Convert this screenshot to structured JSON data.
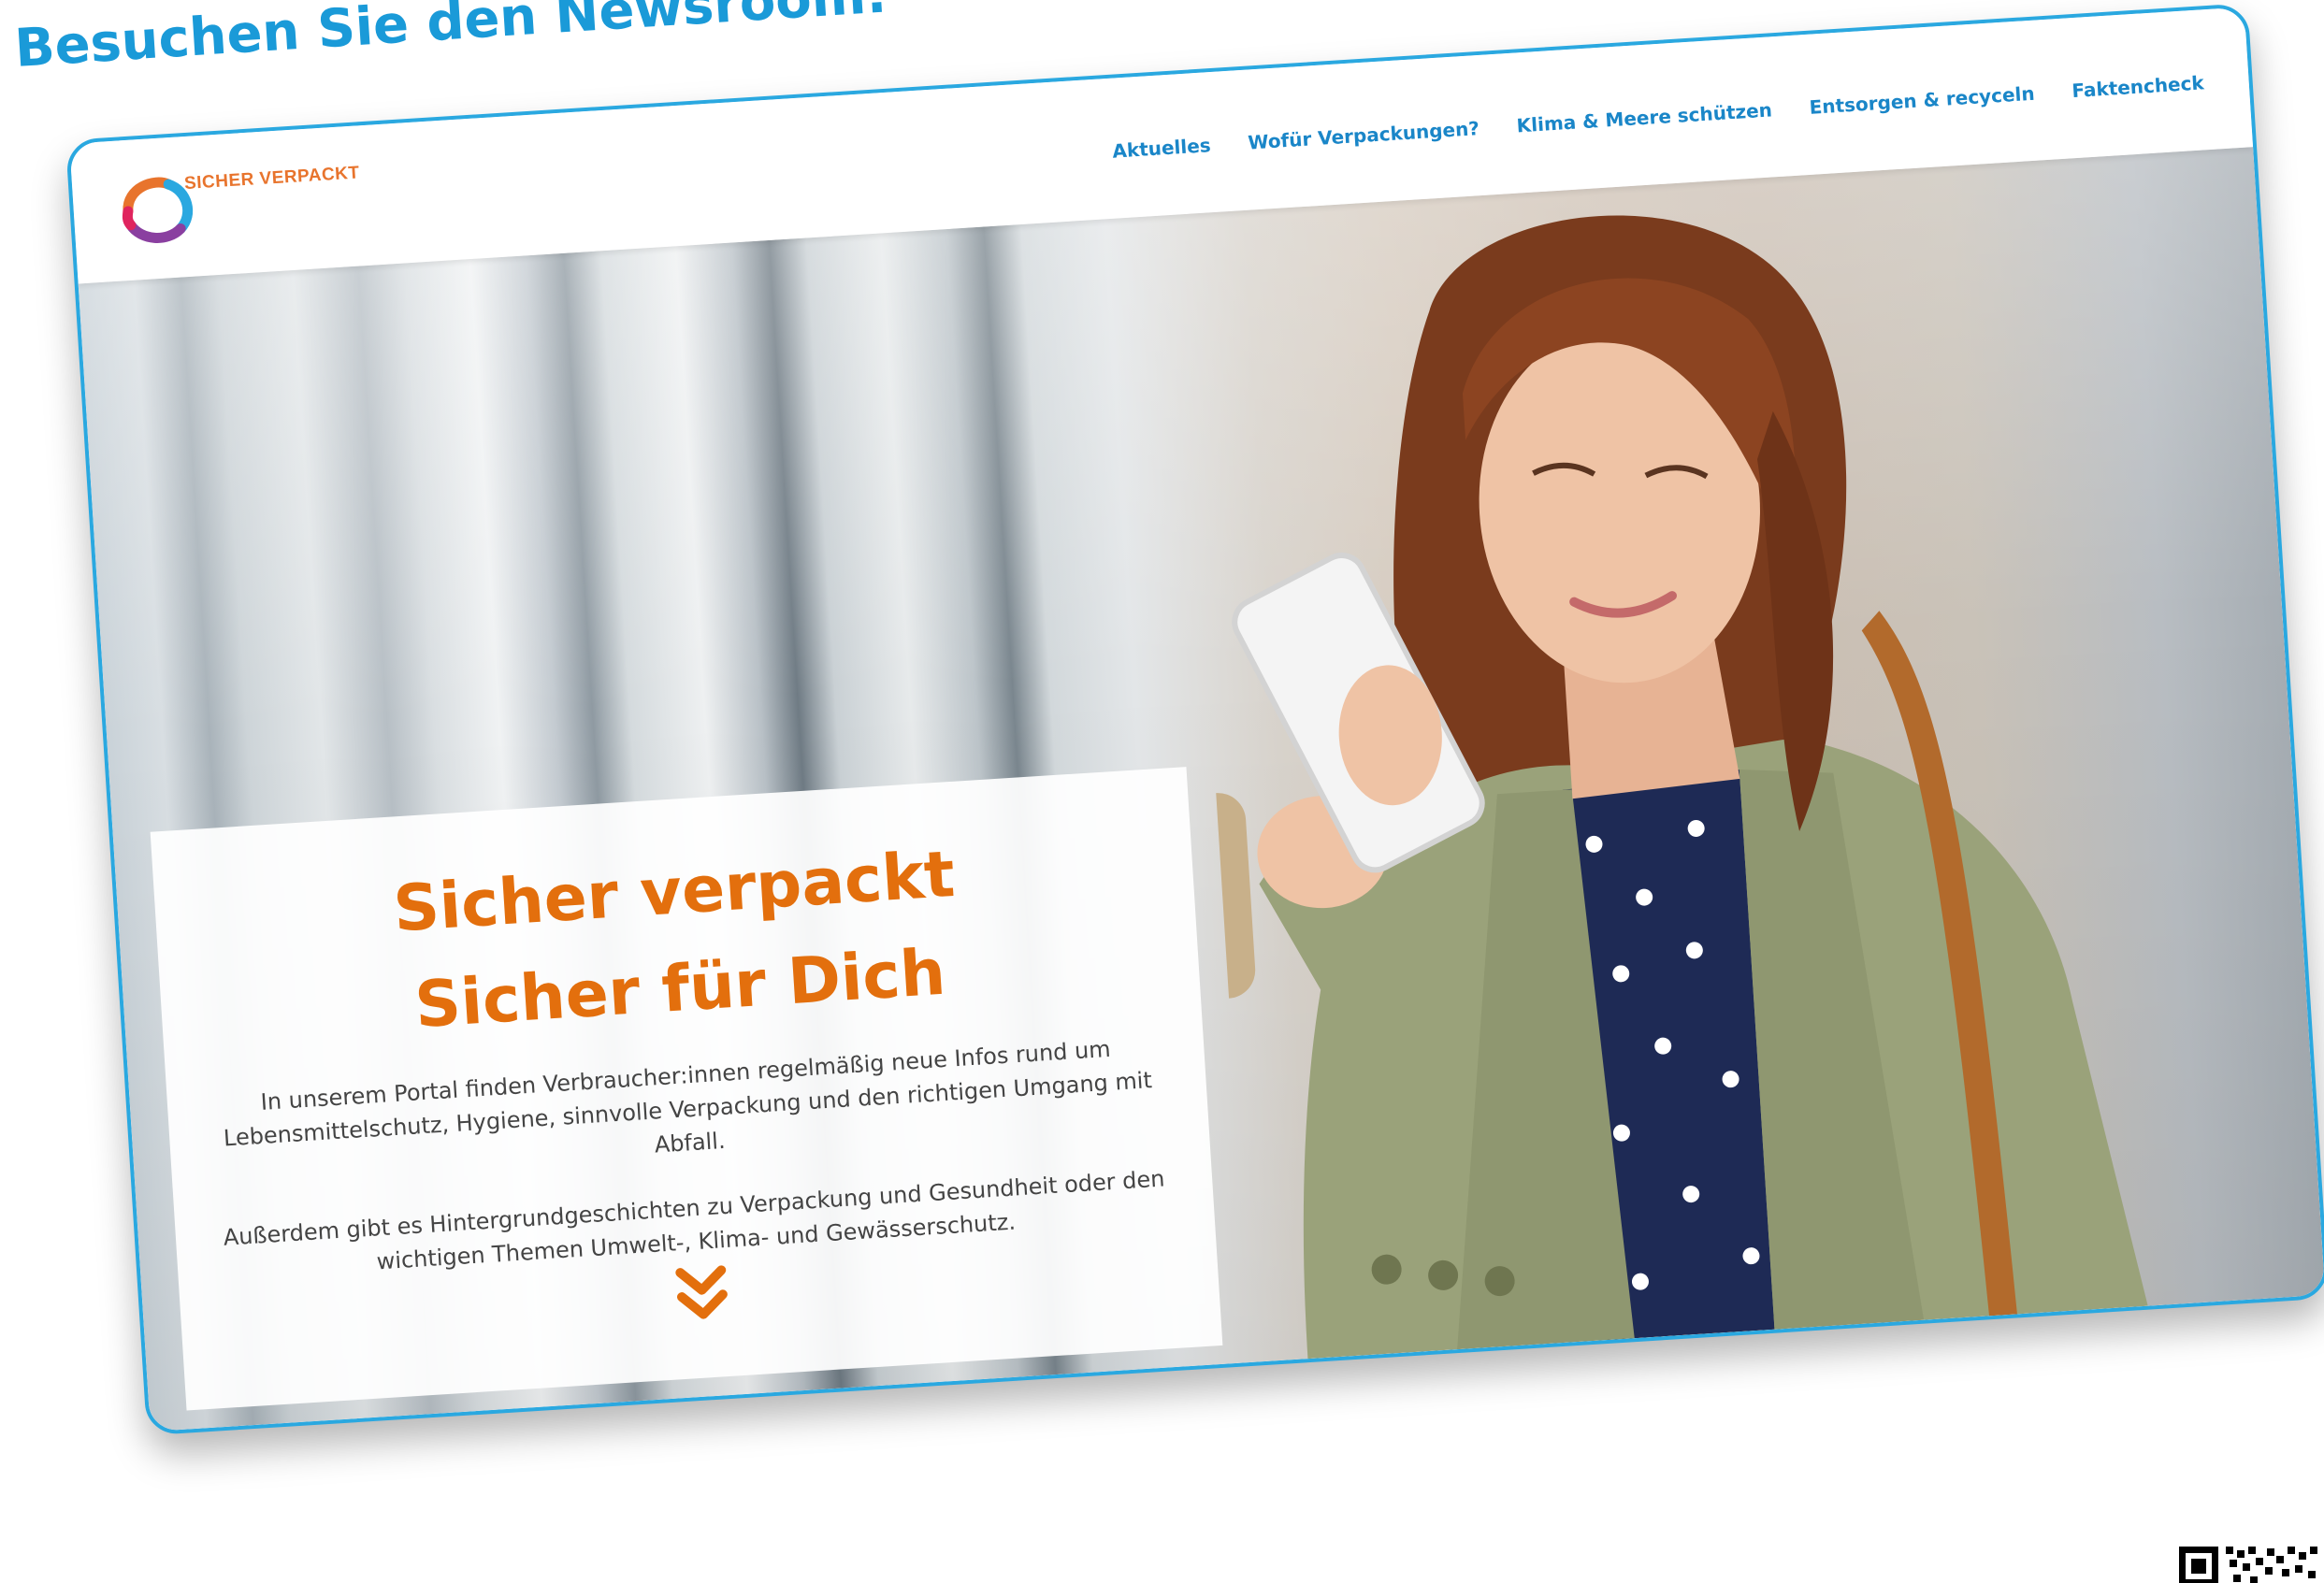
{
  "heading": "Besuchen Sie den Newsroom:",
  "site": {
    "logo_text": "SICHER VERPACKT",
    "nav": [
      "Aktuelles",
      "Wofür Verpackungen?",
      "Klima & Meere schützen",
      "Entsorgen & recyceln",
      "Faktencheck"
    ]
  },
  "hero": {
    "title_line1": "Sicher verpackt",
    "title_line2": "Sicher für Dich",
    "paragraph1": "In unserem Portal finden Verbraucher:innen regelmäßig neue Infos rund um Lebensmittelschutz, Hygiene, sinnvolle Verpackung und den richtigen Umgang mit Abfall.",
    "paragraph2": "Außerdem gibt es Hintergrundgeschichten zu Verpackung und Gesundheit oder den wichtigen Themen Umwelt-, Klima- und Gewässerschutz."
  },
  "icons": {
    "logo": "sicher-verpackt-logo-icon",
    "scroll": "double-chevron-down-icon",
    "qr": "qr-code-icon"
  },
  "colors": {
    "heading": "#1a9ad8",
    "frame_border": "#2aa8e0",
    "nav": "#1a86c8",
    "title": "#e36f0d",
    "logo_text": "#e8742d"
  }
}
